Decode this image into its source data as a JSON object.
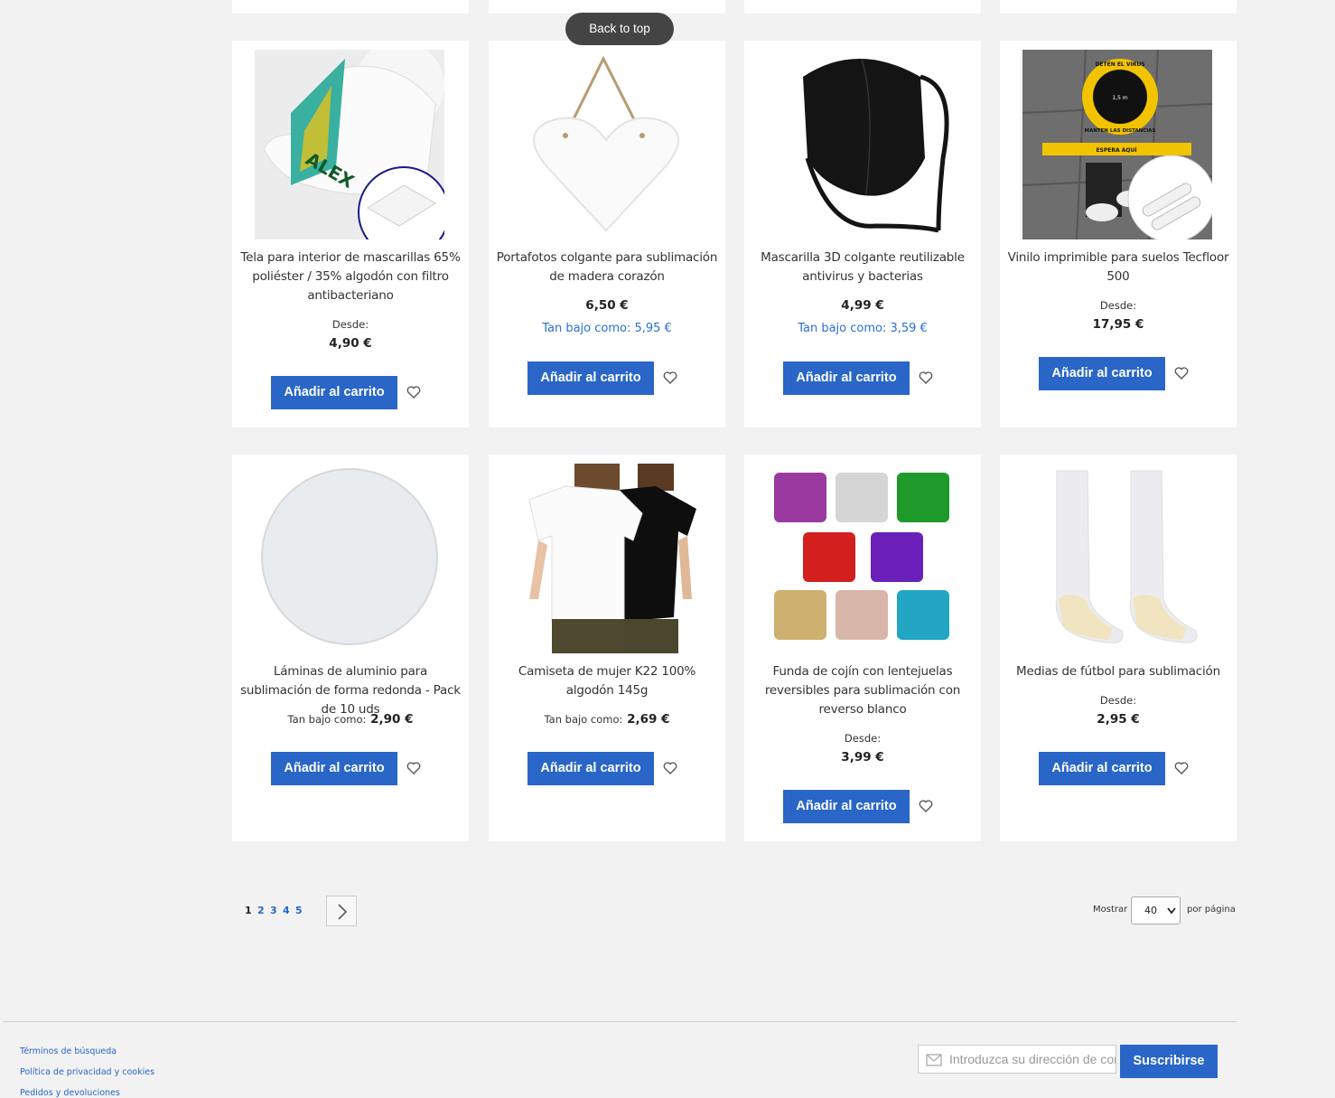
{
  "back_to_top": "Back to top",
  "add_to_cart_label": "Añadir al carrito",
  "products": [
    {
      "name": "Tela para interior de mascarillas 65% poliéster / 35% algodón con filtro antibacteriano",
      "from_label": "Desde:",
      "price": "4,90 €"
    },
    {
      "name": "Portafotos colgante para sublimación de madera corazón",
      "price": "6,50 €",
      "as_low_as": "Tan bajo como: 5,95 €"
    },
    {
      "name": "Mascarilla 3D colgante reutilizable antivirus y bacterias",
      "price": "4,99 €",
      "as_low_as": "Tan bajo como: 3,59 €"
    },
    {
      "name": "Vinilo imprimible para suelos Tecfloor 500",
      "from_label": "Desde:",
      "price": "17,95 €",
      "img_texts": [
        "DETÉN EL VIRUS",
        "MANTEN LAS DISTANCIAS",
        "1,5 m",
        "ESPERA AQUÍ"
      ]
    },
    {
      "name": "Láminas de aluminio para sublimación de forma redonda - Pack de 10 uds",
      "tbc_label": "Tan bajo como:",
      "price": "2,90 €"
    },
    {
      "name": "Camiseta de mujer K22 100% algodón 145g",
      "tbc_label": "Tan bajo como:",
      "price": "2,69 €"
    },
    {
      "name": "Funda de cojín con lentejuelas reversibles para sublimación con reverso blanco",
      "from_label": "Desde:",
      "price": "3,99 €"
    },
    {
      "name": "Medias de fútbol para sublimación",
      "from_label": "Desde:",
      "price": "2,95 €"
    }
  ],
  "mask_print_text": "ALEX",
  "pagination": {
    "pages": [
      "1",
      "2",
      "3",
      "4",
      "5"
    ],
    "current": "1"
  },
  "limiter": {
    "label_before": "Mostrar",
    "value": "40",
    "label_after": "por página"
  },
  "footer": {
    "links": [
      "Términos de búsqueda",
      "Política de privacidad y cookies",
      "Pedidos y devoluciones"
    ],
    "newsletter_placeholder": "Introduzca su dirección de correo electrónico",
    "subscribe_label": "Suscribirse"
  },
  "colors": {
    "accent": "#2966c7",
    "background": "#f2f2f2",
    "link": "#2a6fd6"
  }
}
